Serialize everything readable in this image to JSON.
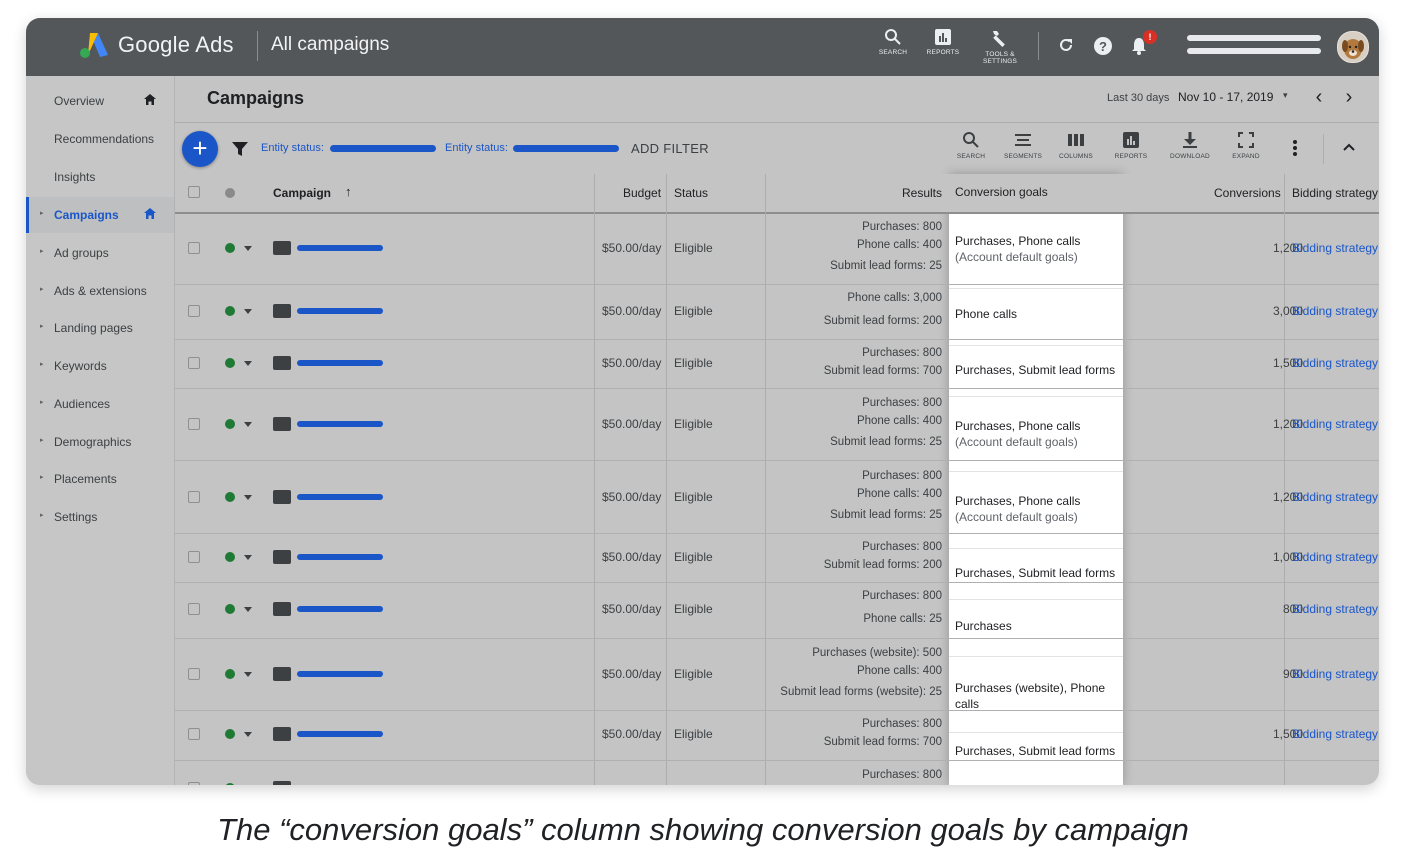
{
  "app": {
    "brand": "Google Ads",
    "page": "All campaigns"
  },
  "top_tools": [
    {
      "label": "SEARCH",
      "icon": "search-icon"
    },
    {
      "label": "REPORTS",
      "icon": "reports-icon"
    },
    {
      "label": "TOOLS & SETTINGS",
      "icon": "wrench-icon"
    }
  ],
  "notification_count": "!",
  "sidebar": {
    "items": [
      {
        "label": "Overview",
        "home": true,
        "arrow": false,
        "active": false
      },
      {
        "label": "Recommendations",
        "home": false,
        "arrow": false,
        "active": false
      },
      {
        "label": "Insights",
        "home": false,
        "arrow": false,
        "active": false
      },
      {
        "label": "Campaigns",
        "home": true,
        "arrow": true,
        "active": true
      },
      {
        "label": "Ad groups",
        "home": false,
        "arrow": true,
        "active": false
      },
      {
        "label": "Ads & extensions",
        "home": false,
        "arrow": true,
        "active": false
      },
      {
        "label": "Landing pages",
        "home": false,
        "arrow": true,
        "active": false
      },
      {
        "label": "Keywords",
        "home": false,
        "arrow": true,
        "active": false
      },
      {
        "label": "Audiences",
        "home": false,
        "arrow": true,
        "active": false
      },
      {
        "label": "Demographics",
        "home": false,
        "arrow": true,
        "active": false
      },
      {
        "label": "Placements",
        "home": false,
        "arrow": true,
        "active": false
      },
      {
        "label": "Settings",
        "home": false,
        "arrow": true,
        "active": false
      }
    ]
  },
  "header": {
    "title": "Campaigns",
    "range_label": "Last 30 days",
    "range": "Nov 10 - 17, 2019"
  },
  "filters": {
    "chip1_label": "Entity status:",
    "chip2_label": "Entity status:",
    "add_filter": "ADD FILTER",
    "tools": [
      "SEARCH",
      "SEGMENTS",
      "COLUMNS",
      "REPORTS",
      "DOWNLOAD",
      "EXPAND"
    ]
  },
  "table": {
    "columns": {
      "campaign": "Campaign",
      "budget": "Budget",
      "status": "Status",
      "results": "Results",
      "goals": "Conversion goals",
      "conversions": "Conversions",
      "bidding": "Bidding strategy"
    },
    "rows": [
      {
        "budget": "$50.00/day",
        "status": "Eligible",
        "results": [
          "Purchases: 800",
          "Phone calls: 400",
          "Submit lead forms: 25"
        ],
        "goal": "Purchases, Phone calls",
        "goal_sub": "(Account default goals)",
        "conversions": "1,200",
        "bidding": "Bidding strategy"
      },
      {
        "budget": "$50.00/day",
        "status": "Eligible",
        "results": [
          "Phone calls: 3,000",
          "Submit lead forms: 200"
        ],
        "goal": "Phone calls",
        "goal_sub": "",
        "conversions": "3,000",
        "bidding": "Bidding strategy"
      },
      {
        "budget": "$50.00/day",
        "status": "Eligible",
        "results": [
          "Purchases: 800",
          "Submit lead forms: 700"
        ],
        "goal": "Purchases, Submit lead forms",
        "goal_sub": "",
        "conversions": "1,500",
        "bidding": "Bidding strategy"
      },
      {
        "budget": "$50.00/day",
        "status": "Eligible",
        "results": [
          "Purchases: 800",
          "Phone calls: 400",
          "Submit lead forms: 25"
        ],
        "goal": "Purchases, Phone calls",
        "goal_sub": "(Account default goals)",
        "conversions": "1,200",
        "bidding": "Bidding strategy"
      },
      {
        "budget": "$50.00/day",
        "status": "Eligible",
        "results": [
          "Purchases: 800",
          "Phone calls: 400",
          "Submit lead forms: 25"
        ],
        "goal": "Purchases, Phone calls",
        "goal_sub": "(Account default goals)",
        "conversions": "1,200",
        "bidding": "Bidding strategy"
      },
      {
        "budget": "$50.00/day",
        "status": "Eligible",
        "results": [
          "Purchases: 800",
          "Submit lead forms: 200"
        ],
        "goal": "Purchases, Submit lead forms",
        "goal_sub": "",
        "conversions": "1,000",
        "bidding": "Bidding strategy"
      },
      {
        "budget": "$50.00/day",
        "status": "Eligible",
        "results": [
          "Purchases: 800",
          "Phone calls: 25"
        ],
        "goal": "Purchases",
        "goal_sub": "",
        "conversions": "800",
        "bidding": "Bidding strategy"
      },
      {
        "budget": "$50.00/day",
        "status": "Eligible",
        "results": [
          "Purchases (website): 500",
          "Phone calls: 400",
          "Submit lead forms (website): 25"
        ],
        "goal": "Purchases (website), Phone calls",
        "goal_sub": "",
        "conversions": "900",
        "bidding": "Bidding strategy"
      },
      {
        "budget": "$50.00/day",
        "status": "Eligible",
        "results": [
          "Purchases: 800",
          "Submit lead forms: 700"
        ],
        "goal": "Purchases, Submit lead forms",
        "goal_sub": "",
        "conversions": "1,500",
        "bidding": "Bidding strategy"
      },
      {
        "budget": "",
        "status": "",
        "results": [
          "Purchases: 800"
        ],
        "goal": "",
        "goal_sub": "",
        "conversions": "",
        "bidding": ""
      }
    ]
  },
  "caption": "The “conversion goals” column showing conversion goals by campaign",
  "colors": {
    "accent": "#1a56c8",
    "topbar": "#54575a",
    "status_green": "#1e7a34",
    "alert": "#d93025"
  }
}
